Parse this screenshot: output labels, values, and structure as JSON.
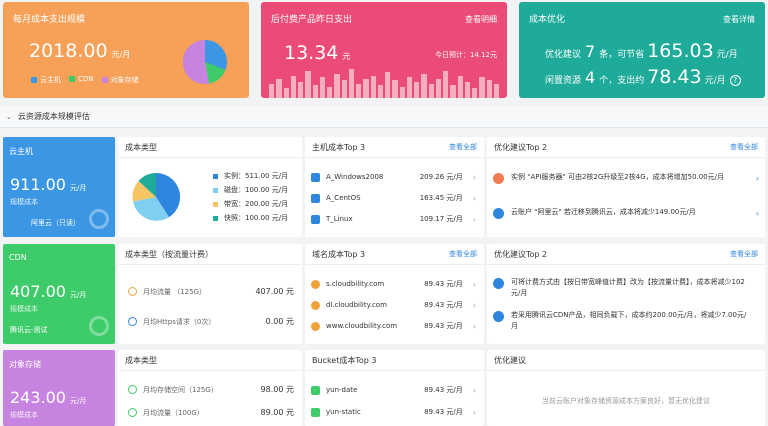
{
  "monthly": {
    "title": "每月成本支出规模",
    "amount": "2018.00",
    "unit": "元/月",
    "legend": [
      "云主机",
      "CDN",
      "对象存储"
    ],
    "legend_colors": [
      "#3b97e3",
      "#3ecb6a",
      "#c683e0"
    ]
  },
  "postpaid": {
    "title": "后付费产品昨日支出",
    "link": "查看明细",
    "amount": "13.34",
    "unit": "元",
    "today_label": "今日预计：14.12元"
  },
  "optimization": {
    "title": "成本优化",
    "link": "查看详情",
    "line1_prefix": "优化建议",
    "line1_count": "7",
    "line1_mid": "条，可节省",
    "line1_amount": "165.03",
    "line1_unit": "元/月",
    "line2_prefix": "闲置资源",
    "line2_count": "4",
    "line2_mid": "个，支出约",
    "line2_amount": "78.43",
    "line2_unit": "元/月",
    "help_icon": "?"
  },
  "section": {
    "title": "云资源成本规模评估"
  },
  "ecs": {
    "name": "云主机",
    "amount": "911.00",
    "unit": "元/月",
    "sub": "规模成本",
    "foot": "阿里云（只读）",
    "type_title": "成本类型",
    "type_items": [
      {
        "label": "实例：",
        "value": "511.00 元/月",
        "color": "#2e86de"
      },
      {
        "label": "磁盘：",
        "value": "100.00 元/月",
        "color": "#7fd0f0"
      },
      {
        "label": "带宽：",
        "value": "200.00 元/月",
        "color": "#f5c463"
      },
      {
        "label": "快照：",
        "value": "100.00 元/月",
        "color": "#1fab9a"
      }
    ],
    "top3_title": "主机成本Top 3",
    "top3_link": "查看全部",
    "top3": [
      {
        "name": "A_Windows2008",
        "value": "209.26 元/月"
      },
      {
        "name": "A_CentOS",
        "value": "163.45 元/月"
      },
      {
        "name": "T_Linux",
        "value": "109.17 元/月"
      }
    ],
    "adv_title": "优化建议Top 2",
    "adv_link": "查看全部",
    "adv": [
      "实例 \"API服务器\" 可由2核2G升级至2核4G，成本将增加50.00元/月",
      "云账户 \"阿里云\" 若迁移到腾讯云，成本将减少149.00元/月"
    ]
  },
  "cdn": {
    "name": "CDN",
    "amount": "407.00",
    "unit": "元/月",
    "sub": "规模成本",
    "foot": "腾讯云-测试",
    "type_title": "成本类型（按流量计费）",
    "metrics": [
      {
        "label": "月均流量 （125G）",
        "value": "407.00 元"
      },
      {
        "label": "月均Https请求（0次）",
        "value": "0.00 元"
      }
    ],
    "top3_title": "域名成本Top 3",
    "top3_link": "查看全部",
    "top3": [
      {
        "name": "s.cloudbility.com",
        "value": "89.43 元/月"
      },
      {
        "name": "dl.cloudbility.com",
        "value": "89.43 元/月"
      },
      {
        "name": "www.cloudbility.com",
        "value": "89.43 元/月"
      }
    ],
    "adv_title": "优化建议Top 2",
    "adv_link": "查看全部",
    "adv": [
      "可将计费方式由【按日带宽峰值计费】改为【按流量计费】，成本将减少102元/月",
      "若采用腾讯云CDN产品，相同负载下，成本约200.00元/月，将减少7.00元/月"
    ]
  },
  "oss": {
    "name": "对象存储",
    "amount": "243.00",
    "unit": "元/月",
    "sub": "规模成本",
    "type_title": "成本类型",
    "metrics": [
      {
        "label": "月均存储空间（125G）",
        "value": "98.00 元"
      },
      {
        "label": "月均流量（100G）",
        "value": "89.00 元"
      }
    ],
    "top3_title": "Bucket成本Top 3",
    "top3": [
      {
        "name": "yun-date",
        "value": "89.43 元/月"
      },
      {
        "name": "yun-static",
        "value": "89.43 元/月"
      }
    ],
    "adv_title": "优化建议",
    "adv_empty": "当前云账户对象存储资源成本方案良好，暂无优化建议"
  }
}
